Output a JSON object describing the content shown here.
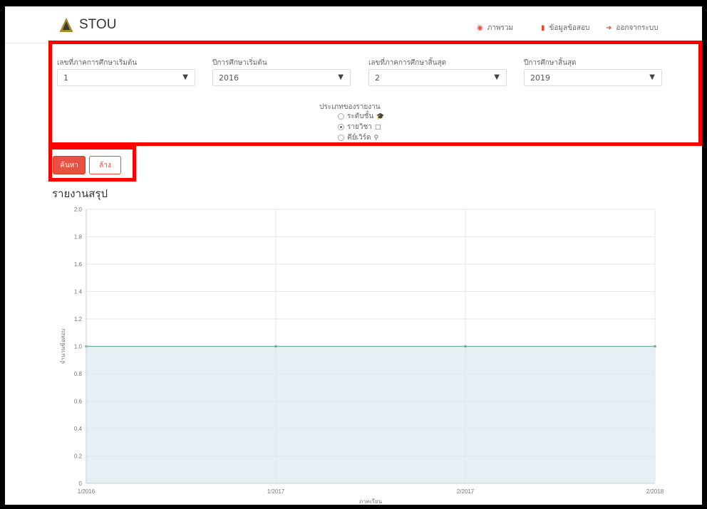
{
  "header": {
    "brand": "STOU",
    "nav": [
      {
        "label": "ภาพรวม",
        "icon": "dashboard-icon"
      },
      {
        "label": "ข้อมูลข้อสอบ",
        "icon": "file-icon"
      },
      {
        "label": "ออกจากระบบ",
        "icon": "logout-icon"
      }
    ]
  },
  "filters": {
    "start_semester": {
      "label": "เลขที่ภาคการศึกษาเริ่มต้น",
      "value": "1"
    },
    "start_year": {
      "label": "ปีการศึกษาเริ่มต้น",
      "value": "2016"
    },
    "end_semester": {
      "label": "เลขที่ภาคการศึกษาสิ้นสุด",
      "value": "2"
    },
    "end_year": {
      "label": "ปีการศึกษาสิ้นสุด",
      "value": "2019"
    },
    "report_type": {
      "label": "ประเภทของรายงาน",
      "options": [
        {
          "label": "ระดับชั้น",
          "checked": false,
          "icon": "graduation-cap-icon"
        },
        {
          "label": "รายวิชา",
          "checked": true,
          "icon": "book-icon"
        },
        {
          "label": "คีย์เวิร์ด",
          "checked": false,
          "icon": "key-icon"
        }
      ]
    }
  },
  "actions": {
    "search_label": "ค้นหา",
    "clear_label": "ล้าง"
  },
  "report": {
    "title": "รายงานสรุป"
  },
  "colors": {
    "accent": "#e74c3c",
    "highlight_box": "#ff0000",
    "series_line": "#6aa8a0",
    "series_fill": "#dce8ef"
  },
  "chart_data": {
    "type": "area",
    "categories": [
      "1/2016",
      "1/2017",
      "2/2017",
      "2/2018"
    ],
    "series": [
      {
        "values": [
          1,
          1,
          1,
          1
        ]
      }
    ],
    "xlabel": "ภาคเรียน",
    "ylabel": "จำนวนข้อสอบ",
    "ylim": [
      0,
      2.0
    ],
    "yticks": [
      "0",
      "0.2",
      "0.4",
      "0.6",
      "0.8",
      "1.0",
      "1.2",
      "1.4",
      "1.6",
      "1.8",
      "2.0"
    ],
    "grid": true
  }
}
